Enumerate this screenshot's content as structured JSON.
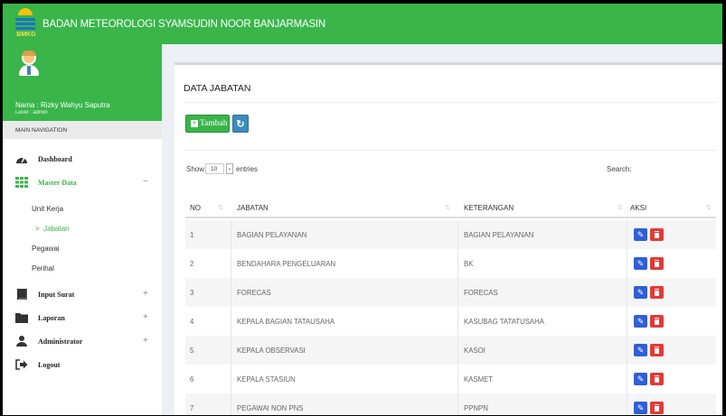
{
  "header": {
    "title": "BADAN METEOROLOGI SYAMSUDIN NOOR BANJARMASIN",
    "logo_text": "BMKG"
  },
  "user": {
    "name": "Nama : Rizky Wahyu Saputra",
    "level": "Level : admin"
  },
  "sidebar": {
    "nav_header": "MAIN NAVIGATION",
    "items": [
      {
        "label": "Dashboard",
        "icon": "dashboard-icon"
      },
      {
        "label": "Master Data",
        "icon": "grid-icon",
        "expander": "−"
      },
      {
        "label": "Input Surat",
        "icon": "book-icon",
        "expander": "+"
      },
      {
        "label": "Laporan",
        "icon": "folder-icon",
        "expander": "+"
      },
      {
        "label": "Administrator",
        "icon": "user-icon",
        "expander": "+"
      },
      {
        "label": "Logout",
        "icon": "logout-icon"
      }
    ],
    "sub_items": [
      {
        "label": "Unit Kerja"
      },
      {
        "label": "Jabatan",
        "prefix": ">"
      },
      {
        "label": "Pegawai"
      },
      {
        "label": "Perihal"
      }
    ]
  },
  "main": {
    "title": "DATA JABATAN",
    "add_button": "Tambah",
    "refresh_icon": "refresh-icon",
    "show_label": "Show",
    "show_value": "10",
    "entries_label": "entries",
    "search_label": "Search:",
    "columns": [
      "NO",
      "JABATAN",
      "KETERANGAN",
      "AKSI"
    ],
    "rows": [
      {
        "no": "1",
        "jabatan": "BAGIAN PELAYANAN",
        "keterangan": "BAGIAN PELAYANAN"
      },
      {
        "no": "2",
        "jabatan": "BENDAHARA PENGELUARAN",
        "keterangan": "BK"
      },
      {
        "no": "3",
        "jabatan": "FORECAS",
        "keterangan": "FORECAS"
      },
      {
        "no": "4",
        "jabatan": "KEPALA BAGIAN TATAUSAHA",
        "keterangan": "KASUBAG TATATUSAHA"
      },
      {
        "no": "5",
        "jabatan": "KEPALA OBSERVASI",
        "keterangan": "KASOI"
      },
      {
        "no": "6",
        "jabatan": "KEPALA STASIUN",
        "keterangan": "KASMET"
      },
      {
        "no": "7",
        "jabatan": "PEGAWAI NON PNS",
        "keterangan": "PPNPN"
      }
    ]
  },
  "colors": {
    "brand_green": "#39b54a",
    "edit_blue": "#2f5fd8",
    "delete_red": "#e53935",
    "refresh_blue": "#3c8dbc"
  }
}
